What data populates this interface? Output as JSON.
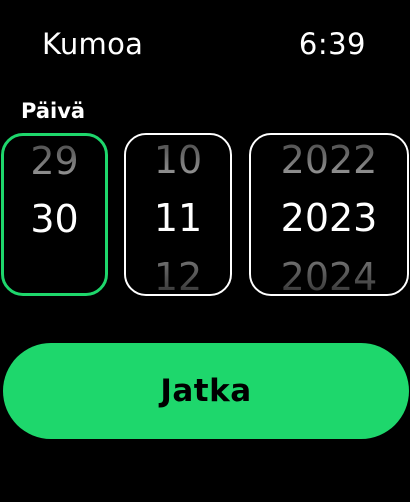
{
  "header": {
    "cancel_label": "Kumoa",
    "time": "6:39"
  },
  "date_picker": {
    "label": "Päivä",
    "day": {
      "prev": "29",
      "selected": "30",
      "next": ""
    },
    "month": {
      "prev": "10",
      "selected": "11",
      "next": "12"
    },
    "year": {
      "prev": "2022",
      "selected": "2023",
      "next": "2024"
    }
  },
  "continue_label": "Jatka",
  "colors": {
    "accent": "#1ed76c",
    "background": "#000000",
    "text": "#ffffff"
  }
}
